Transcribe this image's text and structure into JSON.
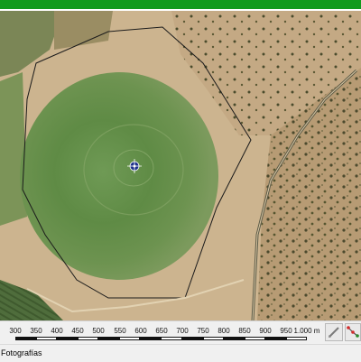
{
  "window": {
    "accent_color": "#119a1c"
  },
  "map": {
    "imagery": "aerial photograph of center-pivot irrigated field",
    "pivot_marker_icon": "crosshair-marker-icon"
  },
  "scale_bar": {
    "ticks": [
      "300",
      "350",
      "400",
      "450",
      "500",
      "550",
      "600",
      "650",
      "700",
      "750",
      "800",
      "850",
      "900",
      "950",
      "1.000 m"
    ],
    "measure_tool_icon": "measure-ruler-icon",
    "draw_tool_icon": "polyline-tool-icon"
  },
  "status": {
    "tab_label": "Fotografías"
  }
}
